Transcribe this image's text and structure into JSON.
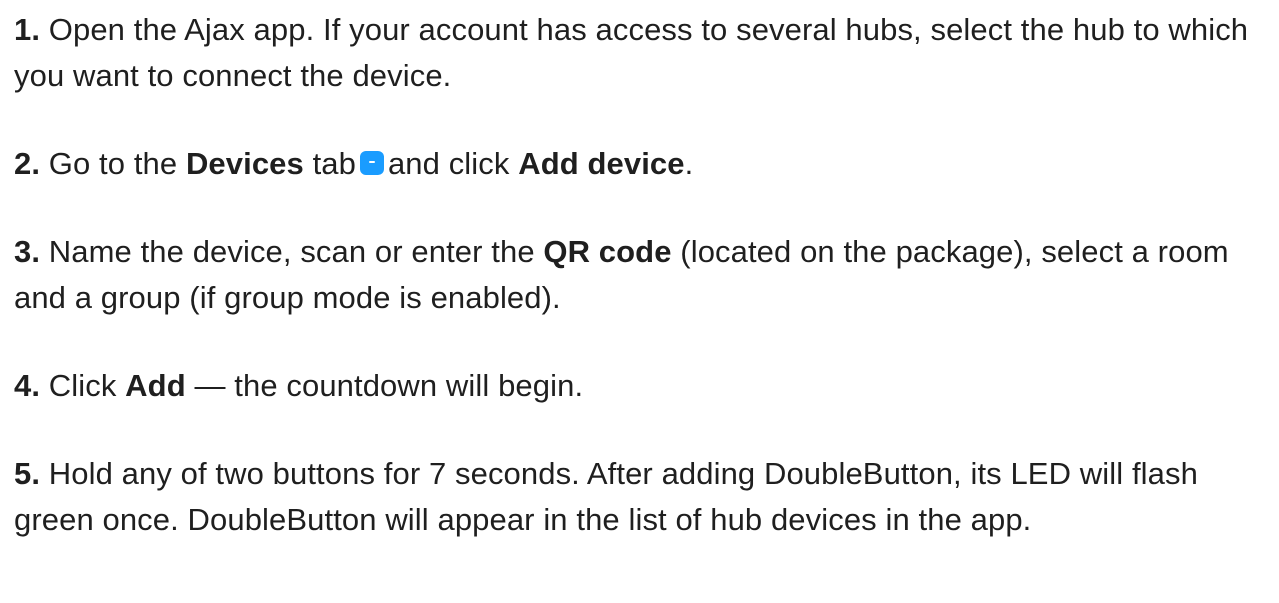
{
  "steps": [
    {
      "number": "1.",
      "text": "Open the Ajax app. If your account has access to several hubs, select the hub to which you want to connect the device."
    },
    {
      "number": "2.",
      "text_a": "Go to the",
      "bold_a": "Devices",
      "text_b": "tab",
      "icon": "devices-tab-icon",
      "text_c": "and click",
      "bold_b": "Add device",
      "text_d": "."
    },
    {
      "number": "3.",
      "text_a": "Name the device, scan or enter the",
      "bold_a": "QR code",
      "text_b": "(located on the package), select a room and a group (if group mode is enabled)."
    },
    {
      "number": "4.",
      "text_a": "Click",
      "bold_a": "Add",
      "text_b": "— the countdown will begin."
    },
    {
      "number": "5.",
      "text": "Hold any of two buttons for 7 seconds. After adding DoubleButton, its LED will flash green once. DoubleButton will appear in the list of hub devices in the app."
    }
  ],
  "colors": {
    "text": "#1f1f1f",
    "icon_bg": "#1a9cff"
  }
}
